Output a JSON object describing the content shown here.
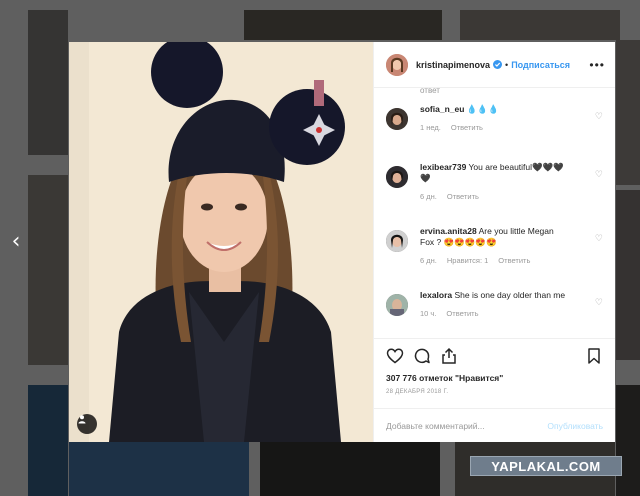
{
  "post": {
    "username": "kristinapimenova",
    "follow_label": "Подписаться",
    "more_label": "•••",
    "likes": "307 776 отметок \"Нравится\"",
    "date": "28 ДЕКАБРЯ 2018 Г.",
    "comment_placeholder": "Добавьте комментарий...",
    "publish_label": "Опубликовать"
  },
  "comments": {
    "cut_text": "ответ",
    "items": [
      {
        "user": "sofia_n_eu",
        "text": "💧💧💧",
        "time": "1 нед.",
        "likes": "",
        "reply": "Ответить"
      },
      {
        "user": "lexibear739",
        "text": "You are beautiful🖤🖤🖤🖤",
        "time": "6 дн.",
        "likes": "",
        "reply": "Ответить"
      },
      {
        "user": "ervina.anita28",
        "text": "Are you little Megan Fox ? 😍😍😍😍😍",
        "time": "6 дн.",
        "likes": "Нравится: 1",
        "reply": "Ответить"
      },
      {
        "user": "lexalora",
        "text": "She is one day older than me",
        "time": "10 ч.",
        "likes": "",
        "reply": "Ответить"
      }
    ]
  },
  "nav": {
    "prev_arrow": "‹"
  },
  "watermark": "YAPLAKAL.COM",
  "icons": [
    "heart-icon",
    "comment-icon",
    "share-icon",
    "bookmark-icon",
    "user-tag-icon",
    "verified-icon",
    "chevron-left-icon"
  ],
  "colors": {
    "accent": "#3897f0",
    "publish_disabled": "#b2dffc",
    "text": "#262626",
    "muted": "#999999"
  }
}
